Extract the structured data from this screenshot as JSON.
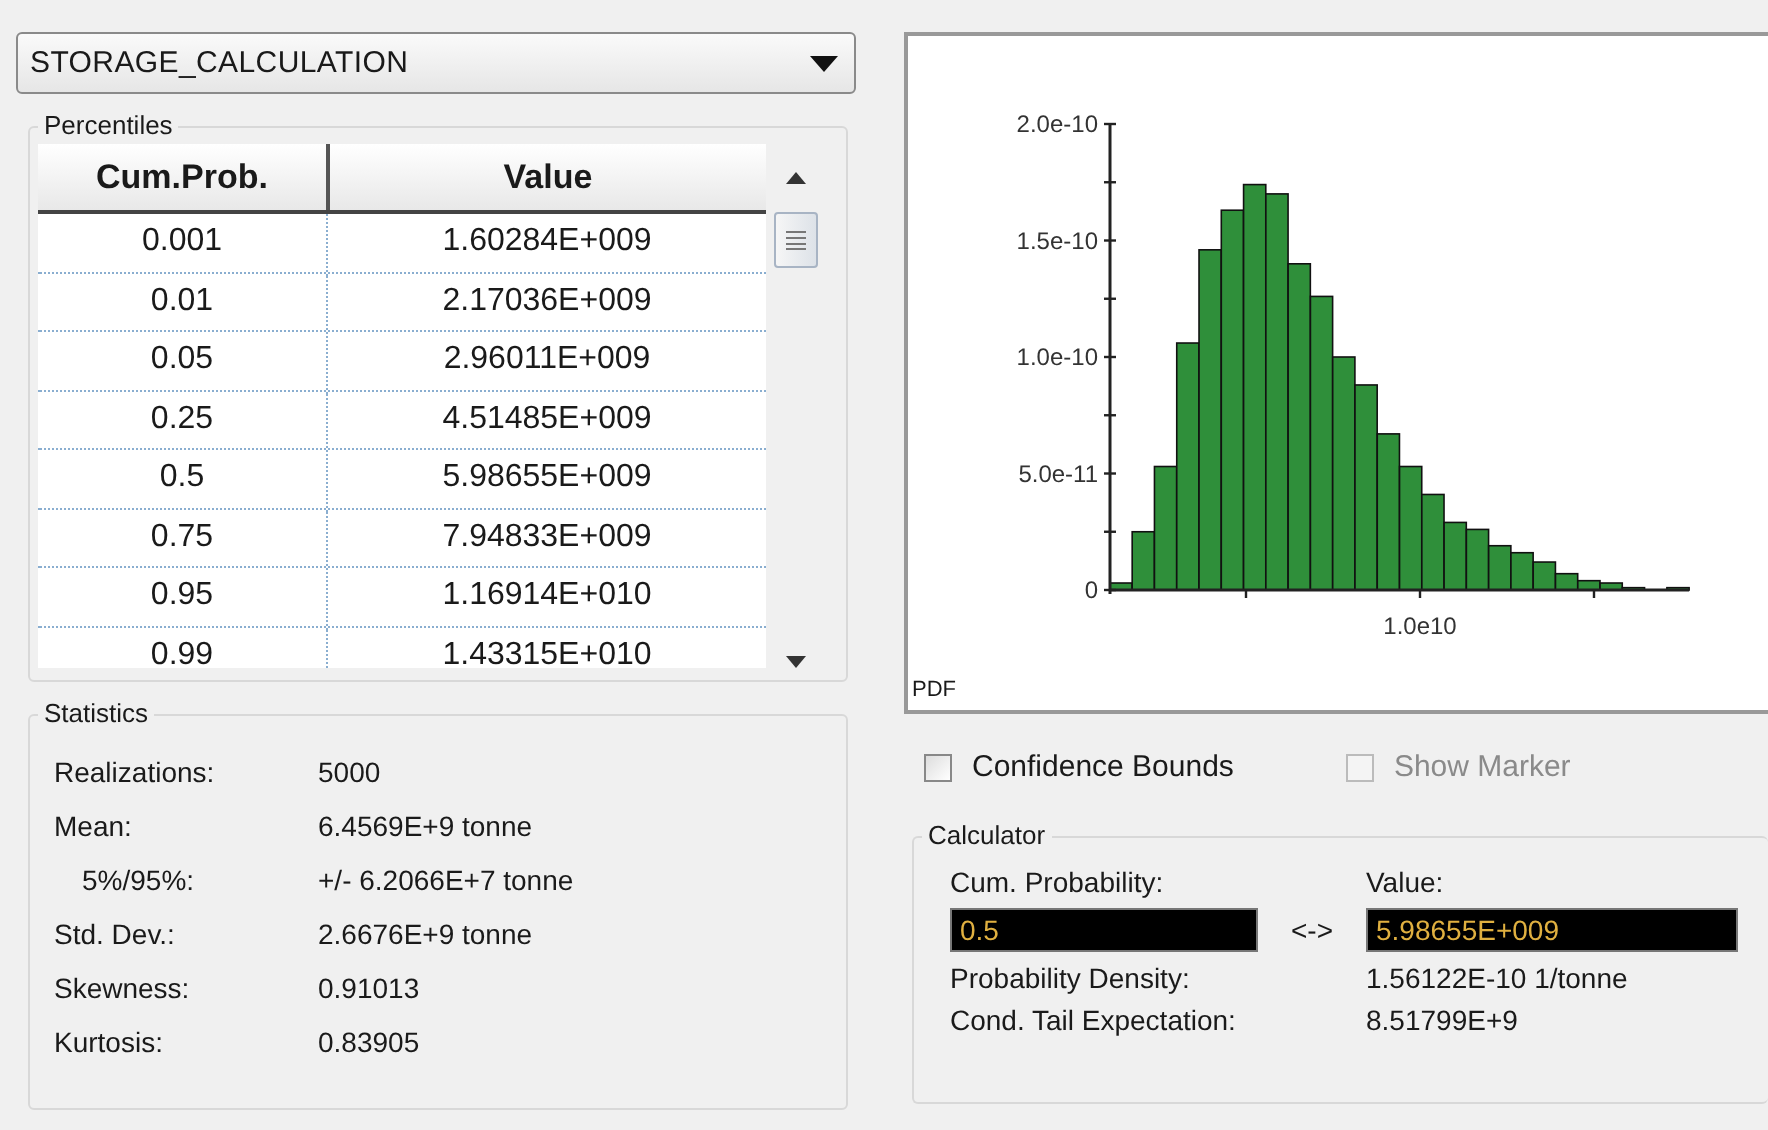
{
  "selector": {
    "value": "STORAGE_CALCULATION"
  },
  "percentiles": {
    "title": "Percentiles",
    "columns": [
      "Cum.Prob.",
      "Value"
    ],
    "rows": [
      {
        "prob": "0.001",
        "value": "1.60284E+009"
      },
      {
        "prob": "0.01",
        "value": "2.17036E+009"
      },
      {
        "prob": "0.05",
        "value": "2.96011E+009"
      },
      {
        "prob": "0.25",
        "value": "4.51485E+009"
      },
      {
        "prob": "0.5",
        "value": "5.98655E+009"
      },
      {
        "prob": "0.75",
        "value": "7.94833E+009"
      },
      {
        "prob": "0.95",
        "value": "1.16914E+010"
      },
      {
        "prob": "0.99",
        "value": "1.43315E+010"
      }
    ]
  },
  "statistics": {
    "title": "Statistics",
    "items": [
      {
        "label": "Realizations:",
        "value": "5000",
        "indented": false
      },
      {
        "label": "Mean:",
        "value": "6.4569E+9 tonne",
        "indented": false
      },
      {
        "label": "5%/95%:",
        "value": "+/- 6.2066E+7 tonne",
        "indented": true
      },
      {
        "label": "Std. Dev.:",
        "value": "2.6676E+9 tonne",
        "indented": false
      },
      {
        "label": "Skewness:",
        "value": "0.91013",
        "indented": false
      },
      {
        "label": "Kurtosis:",
        "value": "0.83905",
        "indented": false
      }
    ]
  },
  "chart": {
    "chart_data": {
      "type": "bar",
      "ylabel": "PDF",
      "series": [
        {
          "color": "#2f8f3a",
          "values": [
            3e-12,
            2.5e-11,
            5.3e-11,
            1.06e-10,
            1.46e-10,
            1.63e-10,
            1.74e-10,
            1.7e-10,
            1.4e-10,
            1.26e-10,
            1e-10,
            8.8e-11,
            6.7e-11,
            5.3e-11,
            4.1e-11,
            2.9e-11,
            2.6e-11,
            1.9e-11,
            1.6e-11,
            1.2e-11,
            7e-12,
            4e-12,
            3e-12,
            1e-12,
            0,
            1e-12
          ]
        }
      ],
      "annotations": [
        "1.0e10"
      ],
      "ylim": [
        0,
        2e-10
      ],
      "yticks": [
        {
          "value": 0,
          "label": "0"
        },
        {
          "value": 5e-11,
          "label": "5.0e-11"
        },
        {
          "value": 1e-10,
          "label": "1.0e-10"
        },
        {
          "value": 1.5e-10,
          "label": "1.5e-10"
        },
        {
          "value": 2e-10,
          "label": "2.0e-10"
        }
      ]
    }
  },
  "options": [
    {
      "label": "Confidence Bounds",
      "checked": false,
      "disabled": false
    },
    {
      "label": "Show Marker",
      "checked": false,
      "disabled": true
    }
  ],
  "calculator": {
    "title": "Calculator",
    "prob_label": "Cum. Probability:",
    "prob_value": "0.5",
    "link": "<->",
    "value_label": "Value:",
    "value_value": "5.98655E+009",
    "results": [
      {
        "label": "Probability Density:",
        "value": "1.56122E-10 1/tonne"
      },
      {
        "label": "Cond. Tail Expectation:",
        "value": "8.51799E+9"
      }
    ]
  }
}
